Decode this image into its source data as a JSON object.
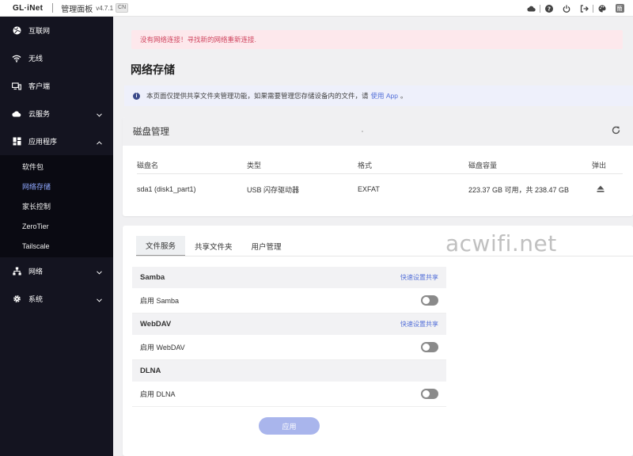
{
  "topbar": {
    "logo": "GL·iNet",
    "panel_title": "管理面板",
    "version": "v4.7.1",
    "lang_badge": "CN",
    "user_badge": "簡"
  },
  "sidebar": {
    "items": [
      {
        "label": "互联网",
        "icon": "globe-icon"
      },
      {
        "label": "无线",
        "icon": "wifi-icon"
      },
      {
        "label": "客户端",
        "icon": "devices-icon"
      },
      {
        "label": "云服务",
        "icon": "cloud-icon"
      },
      {
        "label": "应用程序",
        "icon": "apps-icon"
      },
      {
        "label": "网络",
        "icon": "network-icon"
      },
      {
        "label": "系统",
        "icon": "gear-icon"
      }
    ],
    "apps_subitems": [
      "软件包",
      "网络存储",
      "家长控制",
      "ZeroTier",
      "Tailscale"
    ],
    "active_subitem": "网络存储"
  },
  "main": {
    "alert": "没有网络连接！寻找新的网络重新连接.",
    "page_title": "网络存储",
    "info_text": "本页面仅提供共享文件夹管理功能，如果需要管理您存储设备内的文件，请",
    "info_link": "使用 App",
    "info_end": "。"
  },
  "disk": {
    "title": "磁盘管理",
    "columns": [
      "磁盘名",
      "类型",
      "格式",
      "磁盘容量",
      "弹出"
    ],
    "rows": [
      {
        "name": "sda1 (disk1_part1)",
        "type": "USB 闪存驱动器",
        "format": "EXFAT",
        "capacity": "223.37 GB 可用，共 238.47 GB"
      }
    ]
  },
  "services": {
    "tabs": [
      "文件服务",
      "共享文件夹",
      "用户管理"
    ],
    "active_tab": "文件服务",
    "sections": [
      {
        "title": "Samba",
        "quick": "快速设置共享",
        "row_label": "启用 Samba",
        "enabled": false
      },
      {
        "title": "WebDAV",
        "quick": "快速设置共享",
        "row_label": "启用 WebDAV",
        "enabled": false
      },
      {
        "title": "DLNA",
        "quick": "",
        "row_label": "启用 DLNA",
        "enabled": false
      }
    ],
    "apply_label": "应用"
  },
  "watermark": "acwifi.net",
  "colors": {
    "sidebar_bg": "#141420",
    "accent": "#5470d8",
    "alert_text": "#d0455f",
    "apply_btn": "#a9b5ec"
  }
}
